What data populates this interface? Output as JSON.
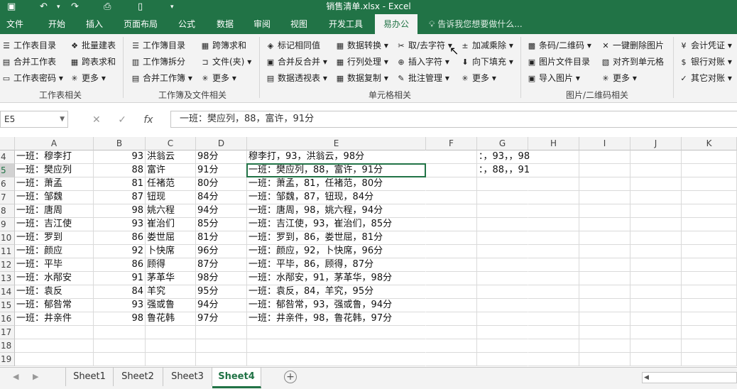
{
  "window": {
    "title": "销售清单.xlsx - Excel",
    "accent": "#217346"
  },
  "quick_access": {
    "save_icon": "save-icon",
    "undo_icon": "undo-icon",
    "redo_icon": "redo-icon",
    "preview_icon": "print-preview-icon",
    "new_icon": "new-file-icon",
    "customize_icon": "customize-icon"
  },
  "tabs": [
    "文件",
    "开始",
    "插入",
    "页面布局",
    "公式",
    "数据",
    "审阅",
    "视图",
    "开发工具",
    "易办公"
  ],
  "active_tab": "易办公",
  "tell_me": "告诉我您想要做什么...",
  "ribbon": {
    "groups": [
      "工作表相关",
      "工作簿及文件相关",
      "单元格相关",
      "图片/二维码相关"
    ],
    "items": [
      "工作表目录",
      "批量建表",
      "合并工作表",
      "跨表求和",
      "工作表密码",
      "更多",
      "工作簿目录",
      "跨簿求和",
      "工作簿拆分",
      "文件(夹)",
      "合并工作簿",
      "更多",
      "标记相同值",
      "数据转换",
      "取/去字符",
      "加减乘除",
      "合并反合并",
      "行列处理",
      "插入字符",
      "向下填充",
      "数据透视表",
      "数据复制",
      "批注管理",
      "更多",
      "条码/二维码",
      "一键删除图片",
      "图片文件目录",
      "对齐到单元格",
      "导入图片",
      "更多",
      "会计凭证",
      "银行对账",
      "其它对账"
    ]
  },
  "formula_bar": {
    "name_box": "E5",
    "formula": "一班：樊应列，88，富许，91分",
    "cancel": "✕",
    "enter": "✓",
    "fx": "fx"
  },
  "columns": [
    "A",
    "B",
    "C",
    "D",
    "E",
    "F",
    "G",
    "H",
    "I",
    "J",
    "K"
  ],
  "rows": [
    {
      "n": "4",
      "a": "一班：穆李打",
      "b": "93",
      "c": "洪翁云",
      "d": "98分",
      "e": "穆李打，93，洪翁云，98分",
      "g": "：，93，，98"
    },
    {
      "n": "5",
      "a": "一班：樊应列",
      "b": "88",
      "c": "富许",
      "d": "91分",
      "e": "一班：樊应列，88，富许，91分",
      "g": "：，88，，91"
    },
    {
      "n": "6",
      "a": "一班：萧孟",
      "b": "81",
      "c": "任褚范",
      "d": "80分",
      "e": "一班：萧孟，81，任褚范，80分",
      "g": ""
    },
    {
      "n": "7",
      "a": "一班：邹魏",
      "b": "87",
      "c": "钮现",
      "d": "84分",
      "e": "一班：邹魏，87，钮现，84分",
      "g": ""
    },
    {
      "n": "8",
      "a": "一班：唐周",
      "b": "98",
      "c": "姚六程",
      "d": "94分",
      "e": "一班：唐周，98，姚六程，94分",
      "g": ""
    },
    {
      "n": "9",
      "a": "一班：吉江使",
      "b": "93",
      "c": "崔治们",
      "d": "85分",
      "e": "一班：吉江使，93，崔治们，85分",
      "g": ""
    },
    {
      "n": "10",
      "a": "一班：罗到",
      "b": "86",
      "c": "娄世屈",
      "d": "81分",
      "e": "一班：罗到，86，娄世屈，81分",
      "g": ""
    },
    {
      "n": "11",
      "a": "一班：颜应",
      "b": "92",
      "c": "卜快席",
      "d": "96分",
      "e": "一班：颜应，92，卜快席，96分",
      "g": ""
    },
    {
      "n": "12",
      "a": "一班：平毕",
      "b": "86",
      "c": "顾得",
      "d": "87分",
      "e": "一班：平毕，86，顾得，87分",
      "g": ""
    },
    {
      "n": "13",
      "a": "一班：水邴安",
      "b": "91",
      "c": "茅革华",
      "d": "98分",
      "e": "一班：水邴安，91，茅革华，98分",
      "g": ""
    },
    {
      "n": "14",
      "a": "一班：袁反",
      "b": "84",
      "c": "羊究",
      "d": "95分",
      "e": "一班：袁反，84，羊究，95分",
      "g": ""
    },
    {
      "n": "15",
      "a": "一班：郁咎常",
      "b": "93",
      "c": "强或鲁",
      "d": "94分",
      "e": "一班：郁咎常，93，强或鲁，94分",
      "g": ""
    },
    {
      "n": "16",
      "a": "一班：井亲件",
      "b": "98",
      "c": "鲁花韩",
      "d": "97分",
      "e": "一班：井亲件，98，鲁花韩，97分",
      "g": ""
    },
    {
      "n": "17",
      "a": "",
      "b": "",
      "c": "",
      "d": "",
      "e": "",
      "g": ""
    },
    {
      "n": "18",
      "a": "",
      "b": "",
      "c": "",
      "d": "",
      "e": "",
      "g": ""
    },
    {
      "n": "19",
      "a": "",
      "b": "",
      "c": "",
      "d": "",
      "e": "",
      "g": ""
    }
  ],
  "selected_cell": "E5",
  "sheets": [
    "Sheet1",
    "Sheet2",
    "Sheet3",
    "Sheet4"
  ],
  "active_sheet": "Sheet4"
}
